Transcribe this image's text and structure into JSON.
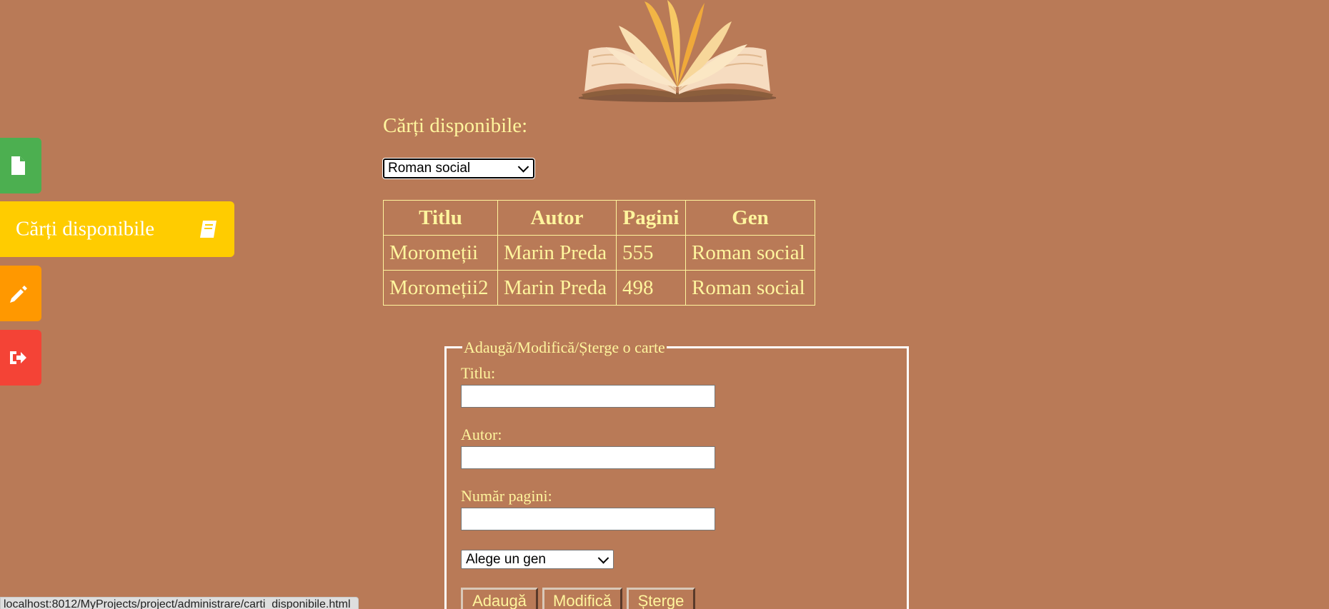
{
  "sidebar": {
    "items": [
      {
        "name": "documents",
        "icon": "file-icon",
        "color": "#4caf50"
      },
      {
        "name": "carti-disponibile",
        "label": "Cărți disponibile",
        "icon": "book-icon",
        "color": "#ffcc00"
      },
      {
        "name": "edit",
        "icon": "pencil-icon",
        "color": "#ff9800"
      },
      {
        "name": "logout",
        "icon": "sign-out-icon",
        "color": "#f44336"
      }
    ]
  },
  "main": {
    "heading": "Cărți disponibile:",
    "genre_filter": {
      "selected": "Roman social"
    },
    "table": {
      "headers": [
        "Titlu",
        "Autor",
        "Pagini",
        "Gen"
      ],
      "rows": [
        [
          "Moromeții",
          "Marin Preda",
          "555",
          "Roman social"
        ],
        [
          "Moromeții2",
          "Marin Preda",
          "498",
          "Roman social"
        ]
      ]
    }
  },
  "form": {
    "legend": "Adaugă/Modifică/Șterge o carte",
    "titlu_label": "Titlu:",
    "titlu_value": "",
    "autor_label": "Autor:",
    "autor_value": "",
    "pagini_label": "Număr pagini:",
    "pagini_value": "",
    "gen_select": "Alege un gen",
    "buttons": {
      "add": "Adaugă",
      "modify": "Modifică",
      "delete": "Șterge"
    }
  },
  "status_url": "localhost:8012/MyProjects/project/administrare/carti_disponibile.html",
  "colors": {
    "background": "#b97a57",
    "text": "#fff59d"
  }
}
